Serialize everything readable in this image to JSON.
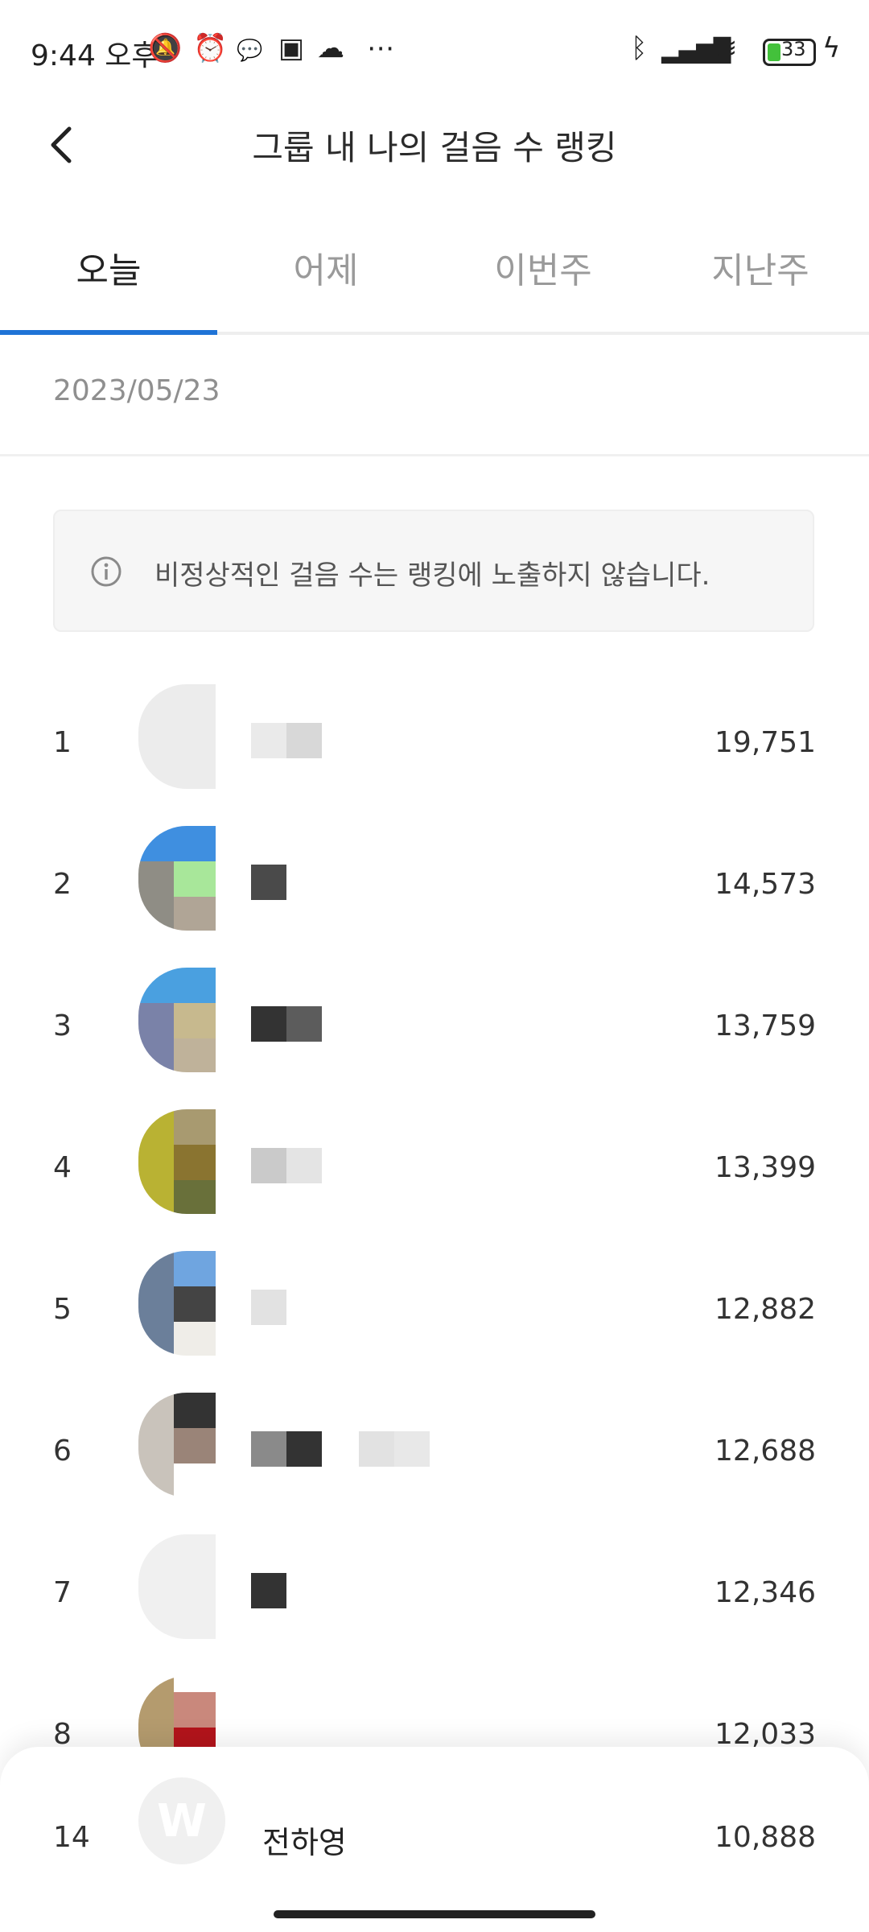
{
  "status_bar": {
    "time": "9:44 오후",
    "battery": "33",
    "icons": [
      "mute-icon",
      "alarm-icon",
      "kakaotalk-icon",
      "instagram-icon",
      "cloud-icon",
      "more-dots-icon",
      "bluetooth-icon",
      "signal-icon",
      "wifi-icon",
      "battery-icon",
      "charging-icon"
    ]
  },
  "header": {
    "title": "그룹 내 나의 걸음 수 랭킹"
  },
  "tabs": [
    {
      "label": "오늘",
      "active": true
    },
    {
      "label": "어제",
      "active": false
    },
    {
      "label": "이번주",
      "active": false
    },
    {
      "label": "지난주",
      "active": false
    }
  ],
  "date": "2023/05/23",
  "notice": "비정상적인 걸음 수는 랭킹에 노출하지 않습니다.",
  "ranking": [
    {
      "rank": "1",
      "steps": "19,751"
    },
    {
      "rank": "2",
      "steps": "14,573"
    },
    {
      "rank": "3",
      "steps": "13,759"
    },
    {
      "rank": "4",
      "steps": "13,399"
    },
    {
      "rank": "5",
      "steps": "12,882"
    },
    {
      "rank": "6",
      "steps": "12,688"
    },
    {
      "rank": "7",
      "steps": "12,346"
    },
    {
      "rank": "8",
      "steps": "12,033"
    }
  ],
  "my_entry": {
    "rank": "14",
    "avatar_letter": "W",
    "name": "전하영",
    "steps": "10,888"
  },
  "colors": {
    "accent": "#1f73d6",
    "inactive_tab": "#9a9a9a",
    "notice_bg": "#f6f6f6"
  }
}
